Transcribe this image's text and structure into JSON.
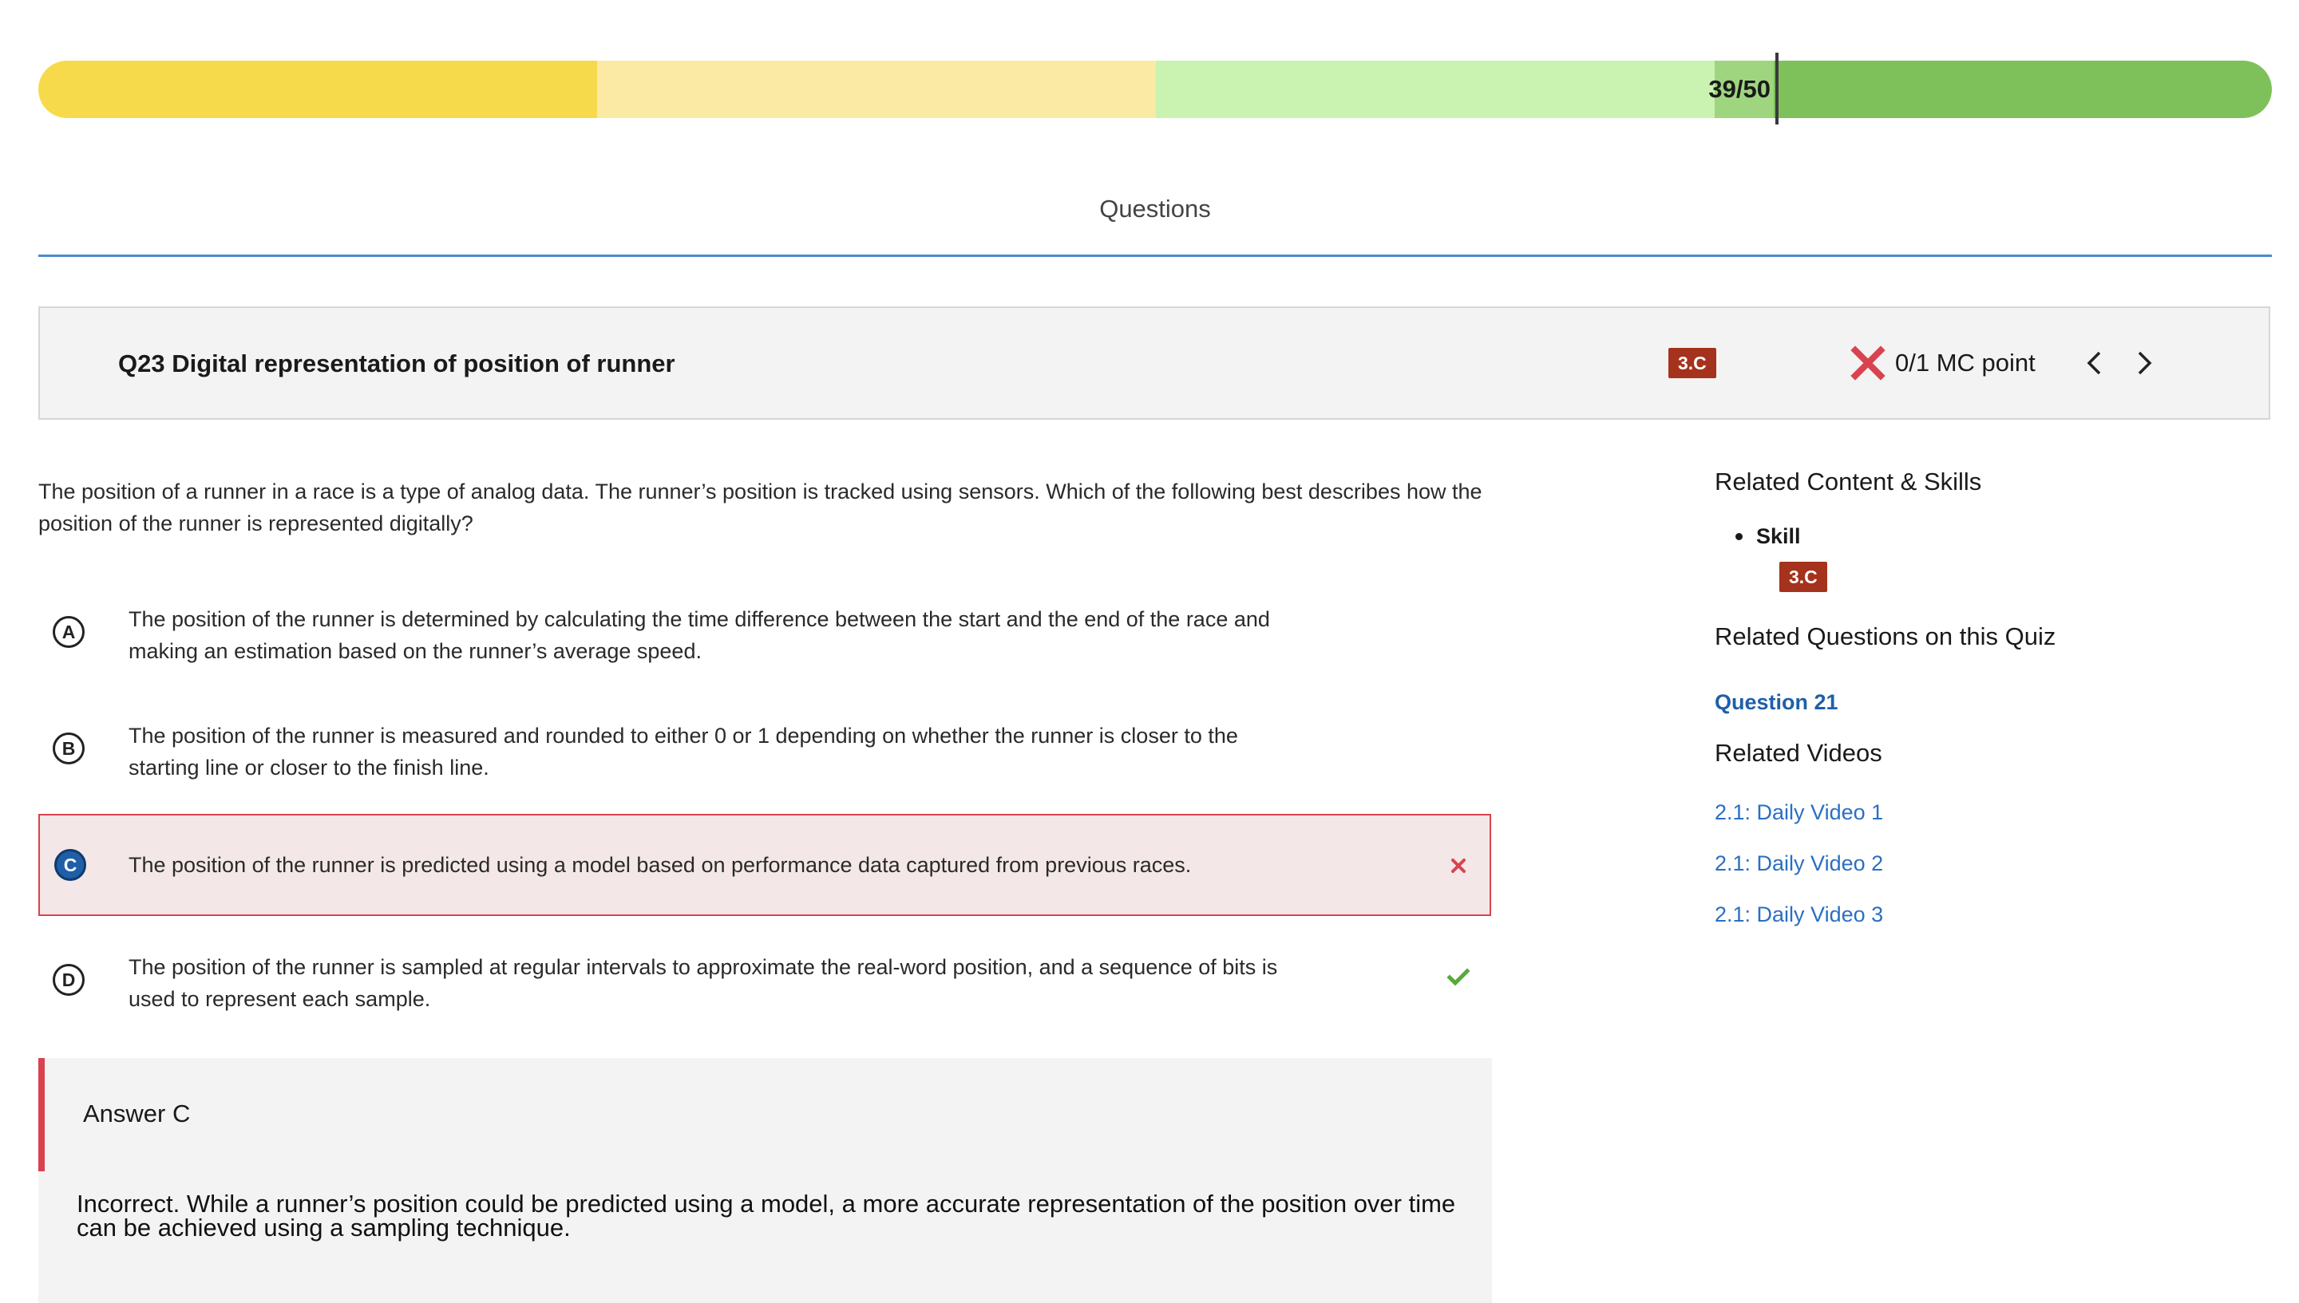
{
  "progress": {
    "score_label": "39/50",
    "score": 39,
    "max": 50,
    "segment_colors": [
      "#f7da4c",
      "#fbeaa4",
      "#caf2b1",
      "#9fd57f",
      "#7ec15a"
    ],
    "marker_color": "#3a3a3a"
  },
  "tab": {
    "title": "Questions"
  },
  "question": {
    "title": "Q23 Digital representation of position of runner",
    "skill_badge": "3.C",
    "points_label": "0/1 MC point",
    "status_icon": "x-icon",
    "prev_icon": "chevron-left-icon",
    "next_icon": "chevron-right-icon",
    "text": "The position of a runner in a race is a type of analog data. The runner’s position is tracked using sensors. Which of the following best describes how the position of the runner is represented digitally?"
  },
  "choices": [
    {
      "letter": "A",
      "text": "The position of the runner is determined by calculating the time difference between the start and the end of the race and making an estimation based on the runner’s average speed."
    },
    {
      "letter": "B",
      "text": "The position of the runner is measured and rounded to either 0 or 1 depending on whether the runner is closer to the starting line or closer to the finish line."
    },
    {
      "letter": "C",
      "text": "The position of the runner is predicted using a model based on performance data captured from previous races.",
      "selected": true,
      "result_icon": "x-icon"
    },
    {
      "letter": "D",
      "text": "The position of the runner is sampled at regular intervals to approximate the real-word position, and a sequence of bits is used to represent each sample.",
      "correct": true,
      "result_icon": "check-icon"
    }
  ],
  "answer": {
    "title": "Answer C",
    "explanation": "Incorrect. While a runner’s position could be predicted using a model, a more accurate representation of the position over time can be achieved using a sampling technique."
  },
  "sidebar": {
    "related_content_heading": "Related Content & Skills",
    "skill_label": "Skill",
    "skill_badge": "3.C",
    "related_questions_heading": "Related Questions on this Quiz",
    "related_question_link": "Question 21",
    "related_videos_heading": "Related Videos",
    "videos": [
      "2.1: Daily Video 1",
      "2.1: Daily Video 2",
      "2.1: Daily Video 3"
    ]
  },
  "colors": {
    "badge": "#a5321c",
    "incorrect": "#d9434f",
    "correct": "#5aa83c",
    "link": "#2a6fc4",
    "tab_rule": "#4a8ad4"
  }
}
